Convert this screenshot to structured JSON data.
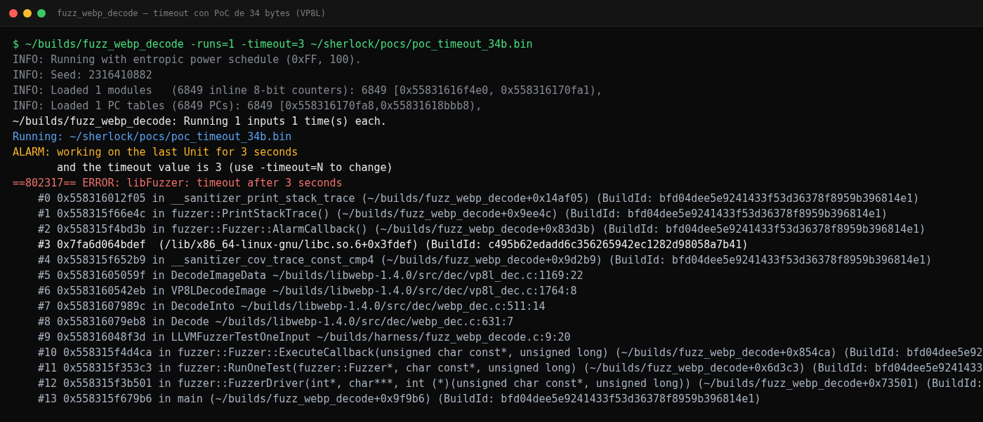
{
  "window": {
    "title": "fuzz_webp_decode — timeout con PoC de 34 bytes (VP8L)"
  },
  "terminal": {
    "lines": [
      {
        "kind": "command",
        "text": "$ ~/builds/fuzz_webp_decode -runs=1 -timeout=3 ~/sherlock/pocs/poc_timeout_34b.bin"
      },
      {
        "kind": "info",
        "text": "INFO: Running with entropic power schedule (0xFF, 100)."
      },
      {
        "kind": "info",
        "text": "INFO: Seed: 2316410882"
      },
      {
        "kind": "info",
        "text": "INFO: Loaded 1 modules   (6849 inline 8-bit counters): 6849 [0x55831616f4e0, 0x558316170fa1),"
      },
      {
        "kind": "info",
        "text": "INFO: Loaded 1 PC tables (6849 PCs): 6849 [0x558316170fa8,0x55831618bbb8),"
      },
      {
        "kind": "plain",
        "text": "~/builds/fuzz_webp_decode: Running 1 inputs 1 time(s) each."
      },
      {
        "kind": "running",
        "text": "Running: ~/sherlock/pocs/poc_timeout_34b.bin"
      },
      {
        "kind": "alarm",
        "text": "ALARM: working on the last Unit for 3 seconds"
      },
      {
        "kind": "continuation",
        "text": "and the timeout value is 3 (use -timeout=N to change)"
      },
      {
        "kind": "error",
        "text": "==802317== ERROR: libFuzzer: timeout after 3 seconds"
      },
      {
        "kind": "frame",
        "text": "#0 0x558316012f05 in __sanitizer_print_stack_trace (~/builds/fuzz_webp_decode+0x14af05) (BuildId: bfd04dee5e9241433f53d36378f8959b396814e1)"
      },
      {
        "kind": "frame",
        "text": "#1 0x558315f66e4c in fuzzer::PrintStackTrace() (~/builds/fuzz_webp_decode+0x9ee4c) (BuildId: bfd04dee5e9241433f53d36378f8959b396814e1)"
      },
      {
        "kind": "frame",
        "text": "#2 0x558315f4bd3b in fuzzer::Fuzzer::AlarmCallback() (~/builds/fuzz_webp_decode+0x83d3b) (BuildId: bfd04dee5e9241433f53d36378f8959b396814e1)"
      },
      {
        "kind": "frame_bright",
        "text": "#3 0x7fa6d064bdef  (/lib/x86_64-linux-gnu/libc.so.6+0x3fdef) (BuildId: c495b62edadd6c356265942ec1282d98058a7b41)"
      },
      {
        "kind": "frame",
        "text": "#4 0x558315f652b9 in __sanitizer_cov_trace_const_cmp4 (~/builds/fuzz_webp_decode+0x9d2b9) (BuildId: bfd04dee5e9241433f53d36378f8959b396814e1)"
      },
      {
        "kind": "frame",
        "text": "#5 0x55831605059f in DecodeImageData ~/builds/libwebp-1.4.0/src/dec/vp8l_dec.c:1169:22"
      },
      {
        "kind": "frame",
        "text": "#6 0x5583160542eb in VP8LDecodeImage ~/builds/libwebp-1.4.0/src/dec/vp8l_dec.c:1764:8"
      },
      {
        "kind": "frame",
        "text": "#7 0x55831607989c in DecodeInto ~/builds/libwebp-1.4.0/src/dec/webp_dec.c:511:14"
      },
      {
        "kind": "frame",
        "text": "#8 0x558316079eb8 in Decode ~/builds/libwebp-1.4.0/src/dec/webp_dec.c:631:7"
      },
      {
        "kind": "frame",
        "text": "#9 0x558316048f3d in LLVMFuzzerTestOneInput ~/builds/harness/fuzz_webp_decode.c:9:20"
      },
      {
        "kind": "frame",
        "text": "#10 0x558315f4d4ca in fuzzer::Fuzzer::ExecuteCallback(unsigned char const*, unsigned long) (~/builds/fuzz_webp_decode+0x854ca) (BuildId: bfd04dee5e92"
      },
      {
        "kind": "frame",
        "text": "#11 0x558315f353c3 in fuzzer::RunOneTest(fuzzer::Fuzzer*, char const*, unsigned long) (~/builds/fuzz_webp_decode+0x6d3c3) (BuildId: bfd04dee5e9241433"
      },
      {
        "kind": "frame",
        "text": "#12 0x558315f3b501 in fuzzer::FuzzerDriver(int*, char***, int (*)(unsigned char const*, unsigned long)) (~/builds/fuzz_webp_decode+0x73501) (BuildId:"
      },
      {
        "kind": "frame",
        "text": "#13 0x558315f679b6 in main (~/builds/fuzz_webp_decode+0x9f9b6) (BuildId: bfd04dee5e9241433f53d36378f8959b396814e1)"
      }
    ]
  }
}
